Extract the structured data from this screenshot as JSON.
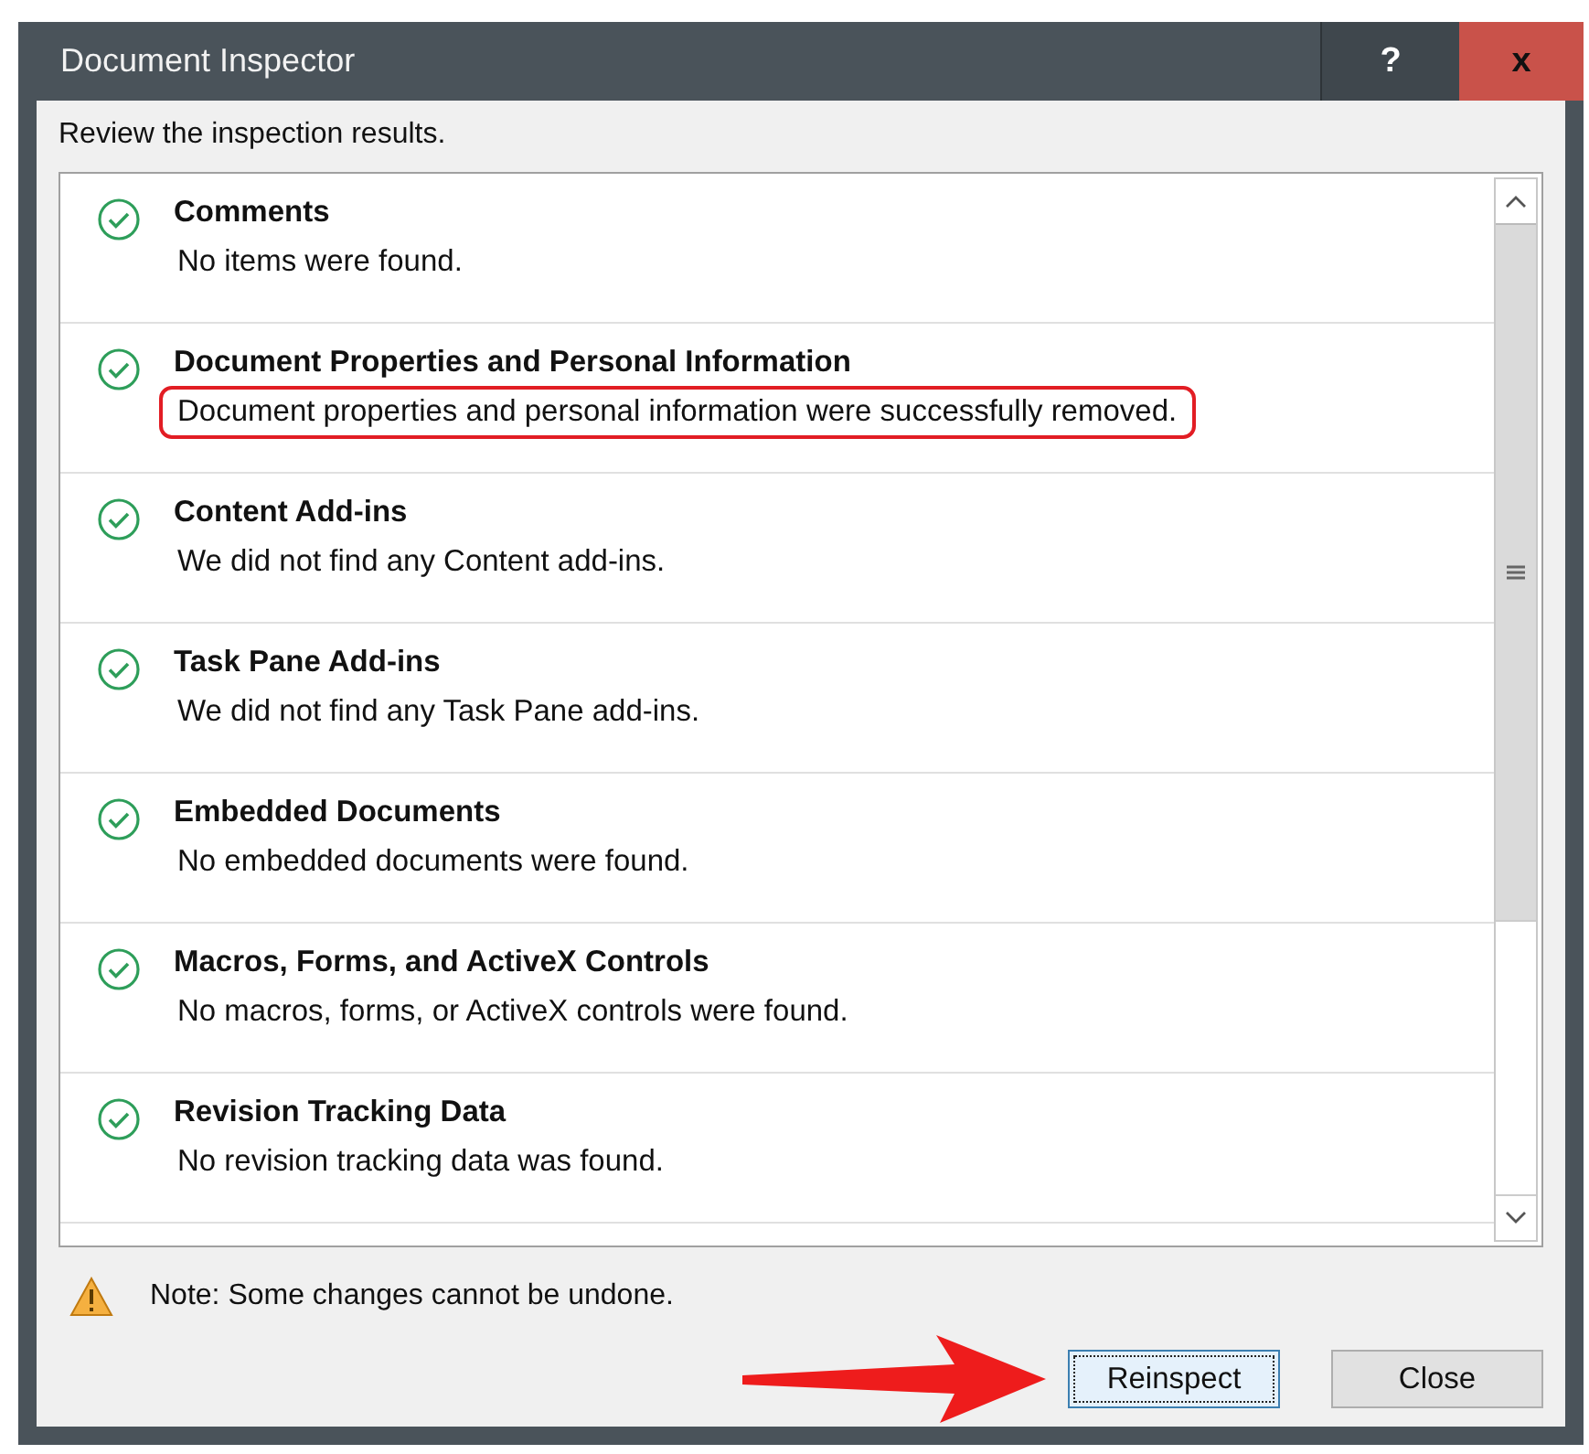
{
  "window": {
    "title": "Document Inspector",
    "help_button": "?",
    "close_button": "x"
  },
  "instruction": "Review the inspection results.",
  "results": [
    {
      "title": "Comments",
      "detail": "No items were found.",
      "passed": true,
      "highlighted": false
    },
    {
      "title": "Document Properties and Personal Information",
      "detail": "Document properties and personal information were successfully removed.",
      "passed": true,
      "highlighted": true
    },
    {
      "title": "Content Add-ins",
      "detail": "We did not find any Content add-ins.",
      "passed": true,
      "highlighted": false
    },
    {
      "title": "Task Pane Add-ins",
      "detail": "We did not find any Task Pane add-ins.",
      "passed": true,
      "highlighted": false
    },
    {
      "title": "Embedded Documents",
      "detail": "No embedded documents were found.",
      "passed": true,
      "highlighted": false
    },
    {
      "title": "Macros, Forms, and ActiveX Controls",
      "detail": "No macros, forms, or ActiveX controls were found.",
      "passed": true,
      "highlighted": false
    },
    {
      "title": "Revision Tracking Data",
      "detail": "No revision tracking data was found.",
      "passed": true,
      "highlighted": false
    }
  ],
  "note": "Note: Some changes cannot be undone.",
  "buttons": [
    {
      "label": "Reinspect",
      "focused": true,
      "pointed_at": true
    },
    {
      "label": "Close",
      "focused": false,
      "pointed_at": false
    }
  ]
}
